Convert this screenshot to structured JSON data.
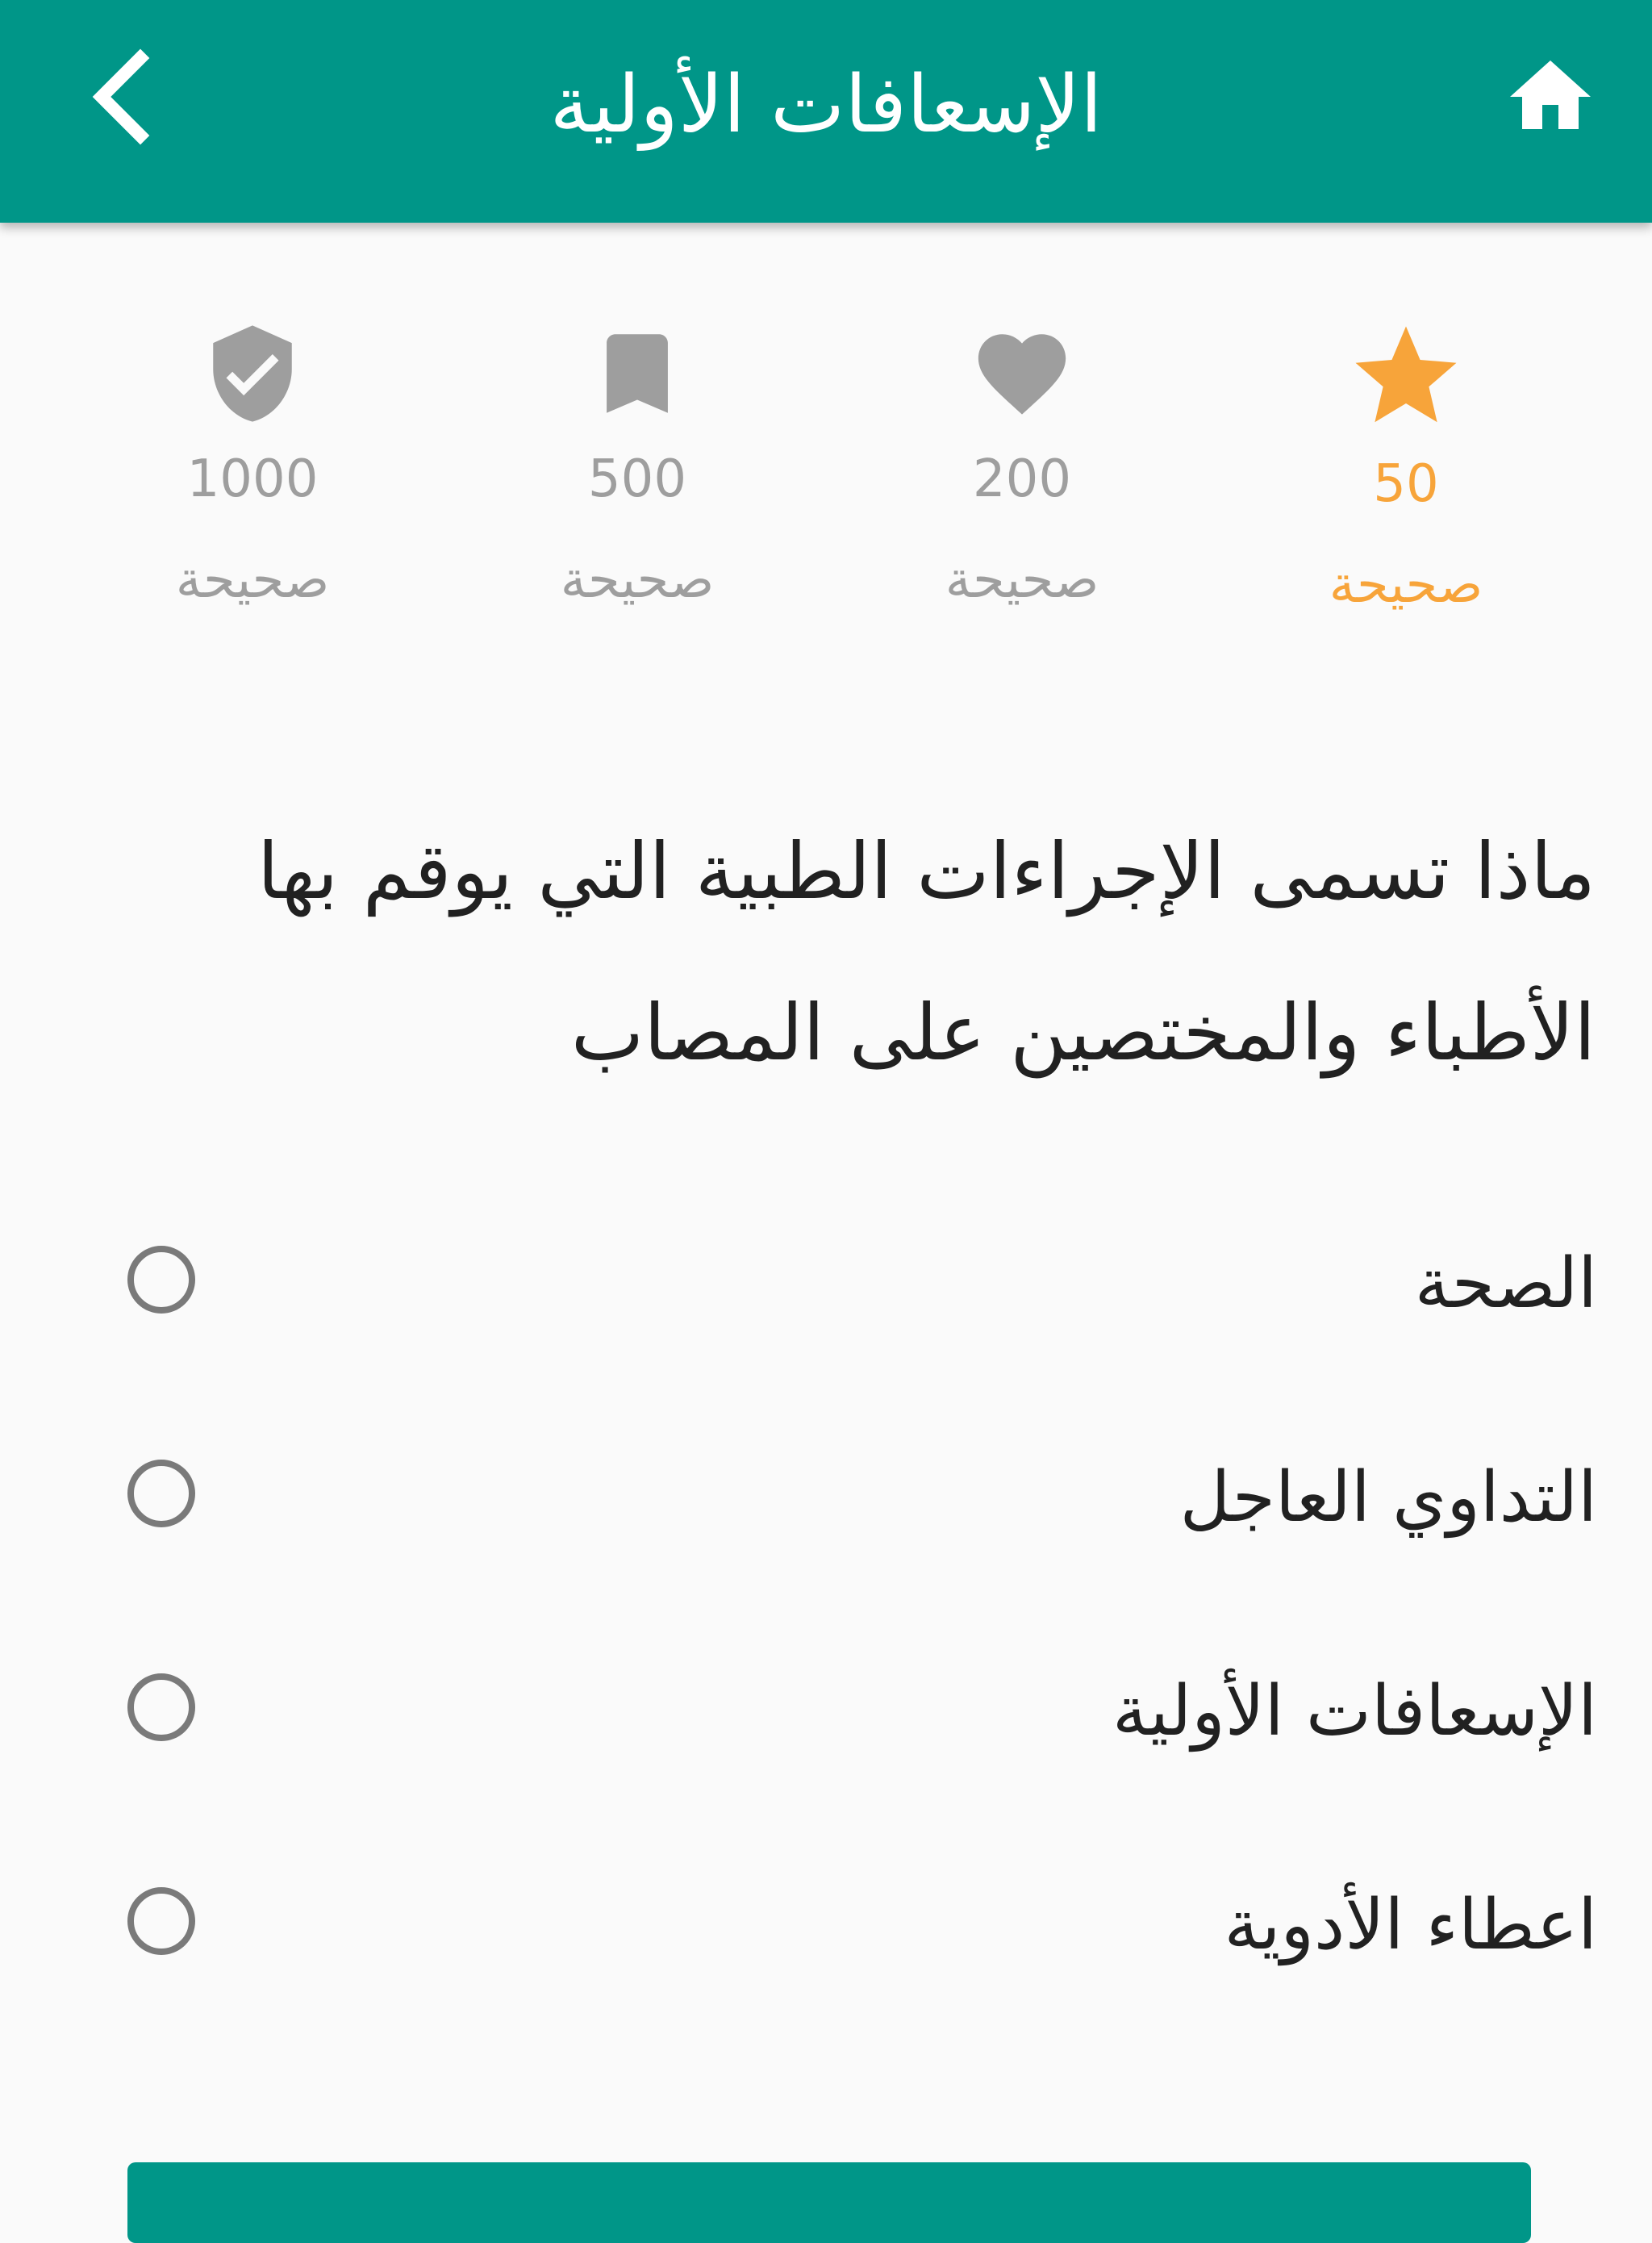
{
  "header": {
    "title": "الإسعافات الأولية",
    "back_icon": "chevron-left-icon",
    "home_icon": "home-icon",
    "background": "#009688"
  },
  "stats": [
    {
      "icon": "verified-shield-icon",
      "count": "1000",
      "label": "صحيحة",
      "active": false
    },
    {
      "icon": "bookmark-icon",
      "count": "500",
      "label": "صحيحة",
      "active": false
    },
    {
      "icon": "heart-icon",
      "count": "200",
      "label": "صحيحة",
      "active": false
    },
    {
      "icon": "star-icon",
      "count": "50",
      "label": "صحيحة",
      "active": true
    }
  ],
  "colors": {
    "accent": "#009688",
    "highlight": "#f7a43a",
    "inactive": "#9e9e9e"
  },
  "question": {
    "text": "ماذا تسمى الإجراءات الطبية التي يوقم بها الأطباء والمختصين على المصاب"
  },
  "options": [
    {
      "label": "الصحة",
      "selected": false
    },
    {
      "label": "التداوي العاجل",
      "selected": false
    },
    {
      "label": "الإسعافات الأولية",
      "selected": false
    },
    {
      "label": "اعطاء الأدوية",
      "selected": false
    }
  ]
}
